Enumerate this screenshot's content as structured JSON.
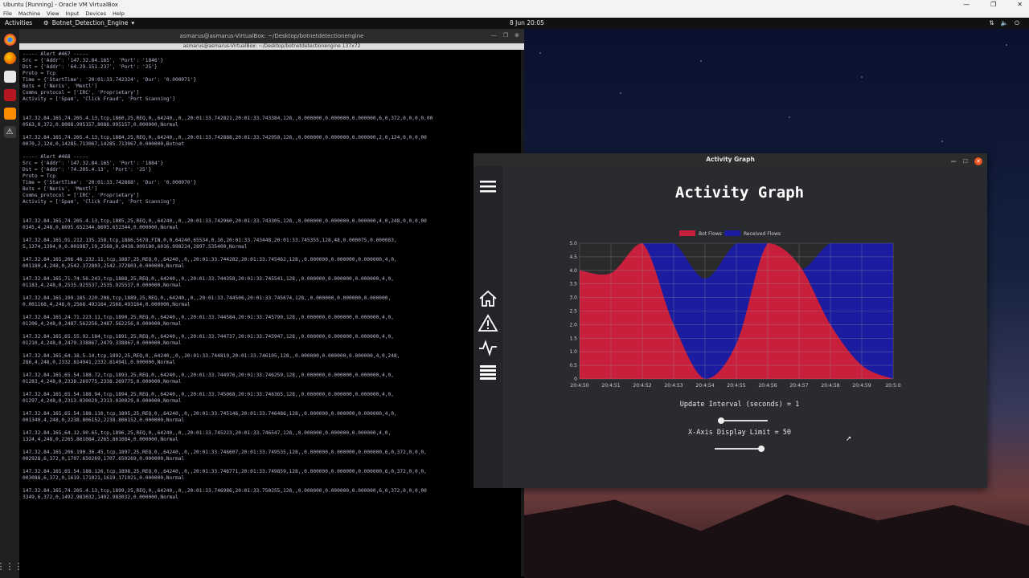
{
  "host": {
    "window_title": "Ubuntu [Running] - Oracle VM VirtualBox",
    "menu": [
      "File",
      "Machine",
      "View",
      "Input",
      "Devices",
      "Help"
    ]
  },
  "topbar": {
    "activities": "Activities",
    "app_name": "Botnet_Detection_Engine",
    "clock": "8 Jun  20:05"
  },
  "terminal": {
    "title": "asmarus@asmarus-VirtualBox: ~/Desktop/botnetdetectionengine",
    "tab": "asmarus@asmarus-VirtualBox: ~/Desktop/botnetdetectionengine 137x72",
    "lines": [
      "----- Alert #467 -----",
      "Src = {'Addr': '147.32.84.165', 'Port': '1846'}",
      "Dst = {'Addr': '64.29.151.237', 'Port': '25'}",
      "Proto = Tcp",
      "Time = {'StartTime': '20:01:33.742324', 'Dur': '0.000071'}",
      "Bots = ['Neris', 'Mentl']",
      "Comms_protocol = ['IRC', 'Proprietary']",
      "Activity = ['Spam', 'Click Fraud', 'Port Scanning']",
      "",
      "",
      "147.32.84.165,74.205.4.13,tcp,1860,25,REQ,0,,64240,,0,,20:01:33.742821,20:01:33.743384,128,,0.000000,0.000000,0.000000,6,0,372,0,0,0,0,00",
      "0563,0,372,0.8088.995157,8088.995157,0.000000,Normal",
      "",
      "147.32.84.165,74.205.4.13,tcp,1884,25,REQ,0,,64240,,0,,20:01:33.742888,20:01:33.742958,128,,0.000000,0.000000,0.000000,2,0,124,0,0,0,00",
      "0070,2,124,0,14285.713067,14285.713067,0.000000,Botnet",
      "",
      "----- Alert #468 -----",
      "Src = {'Addr': '147.32.84.165', 'Port': '1884'}",
      "Dst = {'Addr': '74.205.4.13', 'Port': '25'}",
      "Proto = Tcp",
      "Time = {'StartTime': '20:01:33.742888', 'Dur': '0.000070'}",
      "Bots = ['Neris', 'Mentl']",
      "Comms_protocol = ['IRC', 'Proprietary']",
      "Activity = ['Spam', 'Click Fraud', 'Port Scanning']",
      "",
      "",
      "147.32.84.165,74.205.4.13,tcp,1885,25,REQ,0,,64240,,0,,20:01:33.742960,20:01:33.743305,128,,0.000000,0.000000,0.000000,4,0,248,0,0,0,00",
      "0345,4,248,0,8695.652344,8695.652344,0.000000,Normal",
      "",
      "147.32.84.165,91.212.135.158,tcp,1886,5678,FIN,0,0,64240,65534,0,16,20:01:33.743448,20:01:33.745355,128,48,0.000075,0.000083,",
      "5,1374,1394,0,0.001987,19,2568,0,9438.909180,6016.998224,2897.535400,Normal",
      "",
      "147.32.84.165,206.46.232.11,tcp,1887,25,REQ,0,,64240,,0,,20:01:33.744282,20:01:33.745462,128,,0.000000,0.000000,0.000000,4,0,",
      "001180,4,248,0,2542.372803,2542.372803,0.000000,Normal",
      "",
      "147.32.84.165,71.74.56.243,tcp,1888,25,REQ,0,,64240,,0,,20:01:33.744358,20:01:33.745541,128,,0.000000,0.000000,0.000000,4,0,",
      "01183,4,248,0,2535.925537,2535.925537,0.000000,Normal",
      "",
      "147.32.84.165,199.185.220.208,tcp,1889,25,REQ,0,,64240,,0,,20:01:33.744506,20:01:33.745674,128,,0.000000,0.000000,0.000000,",
      "0.001168,4,248,0,2568.493164,2568.493164,0.000000,Normal",
      "",
      "147.32.84.165,24.71.223.11,tcp,1890,25,REQ,0,,64240,,0,,20:01:33.744584,20:01:33.745790,128,,0.000000,0.000000,0.000000,4,0,",
      "01206,4,248,0,2487.562256,2487.562256,0.000000,Normal",
      "",
      "147.32.84.165,65.55.92.184,tcp,1891,25,REQ,0,,64240,,0,,20:01:33.744737,20:01:33.745947,128,,0.000000,0.000000,0.000000,4,0,",
      "01210,4,248,0,2479.338867,2479.338867,0.000000,Normal",
      "",
      "147.32.84.165,64.18.5.14,tcp,1892,25,REQ,0,,64240,,0,,20:01:33.744819,20:01:33.746105,128,,0.000000,0.000000,0.000000,4,0,248,",
      "286,4,248,0,2332.814941,2332.814941,0.000000,Normal",
      "",
      "147.32.84.165,65.54.188.72,tcp,1893,25,REQ,0,,64240,,0,,20:01:33.744976,20:01:33.746259,128,,0.000000,0.000000,0.000000,4,0,",
      "01283,4,248,0,2338.269775,2338.269775,0.000000,Normal",
      "",
      "147.32.84.165,65.54.188.94,tcp,1894,25,REQ,0,,64240,,0,,20:01:33.745068,20:01:33.746365,128,,0.000000,0.000000,0.000000,4,0,",
      "01297,4,248,0,2313.030029,2313.030029,0.000000,Normal",
      "",
      "147.32.84.165,65.54.188.110,tcp,1895,25,REQ,0,,64240,,0,,20:01:33.745146,20:01:33.746486,128,,0.000000,0.000000,0.000000,4,0,",
      "001340,4,248,0,2238.806152,2238.806152,0.000000,Normal",
      "",
      "147.32.84.165,64.12.90.65,tcp,1896,25,REQ,0,,64240,,0,,20:01:33.745223,20:01:33.746547,128,,0.000000,0.000000,0.000000,4,0,",
      "1324,4,248,0,2265.861084,2265.861084,0.000000,Normal",
      "",
      "147.32.84.165,206.190.36.45,tcp,1897,25,REQ,0,,64240,,0,,20:01:33.746607,20:01:33.749535,128,,0.000000,0.000000,0.000000,6,0,372,0,0,0,",
      "002928,6,372,0,1707.650269,1707.650269,0.000000,Normal",
      "",
      "147.32.84.165,65.54.188.126,tcp,1898,25,REQ,0,,64240,,0,,20:01:33.746771,20:01:33.749859,128,,0.000000,0.000000,0.000000,6,0,372,0,0,0,",
      "003088,6,372,0,1619.171021,1619.171021,0.000000,Normal",
      "",
      "147.32.84.165,74.205.4.13,tcp,1899,25,REQ,0,,64240,,0,,20:01:33.746986,20:01:33.750255,128,,0.000000,0.000000,0.000000,6,0,372,0,0,0,00",
      "3349,6,372,0,1492.983032,1492.983032,0.000000,Normal"
    ]
  },
  "activity_window": {
    "title": "Activity Graph",
    "heading": "Activity Graph",
    "update_interval_label": "Update Interval (seconds) = 1",
    "update_interval_fraction": 0.0,
    "xaxis_limit_label": "X-Axis Display Limit = 50",
    "xaxis_limit_fraction": 1.0
  },
  "colors": {
    "bot": "#c8203c",
    "received": "#1c1ca0",
    "chart_bg": "#2b2b2b"
  },
  "chart_data": {
    "type": "area",
    "legend": [
      "Bot Flows",
      "Received Flows"
    ],
    "legend_position": "top-center",
    "x_ticks": [
      "20:4:50",
      "20:4:51",
      "20:4:52",
      "20:4:53",
      "20:4:54",
      "20:4:55",
      "20:4:56",
      "20:4:57",
      "20:4:58",
      "20:4:59",
      "20:5:0"
    ],
    "y_ticks": [
      "0",
      "0.5",
      "1.0",
      "1.5",
      "2.0",
      "2.5",
      "3.0",
      "3.5",
      "4.0",
      "4.5",
      "5.0"
    ],
    "ylim": [
      0,
      5
    ],
    "grid": true,
    "series": [
      {
        "name": "Bot Flows",
        "values": [
          4.0,
          3.9,
          5.0,
          2.0,
          0.0,
          1.3,
          5.0,
          4.2,
          2.0,
          0.5,
          0.0
        ]
      },
      {
        "name": "Received Flows",
        "values": [
          4.0,
          3.9,
          5.0,
          5.0,
          3.7,
          5.0,
          5.0,
          4.0,
          5.0,
          5.0,
          5.0
        ]
      }
    ]
  }
}
